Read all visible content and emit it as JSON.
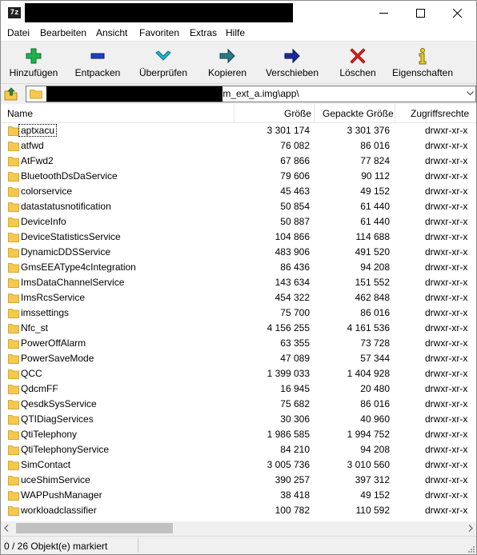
{
  "window": {
    "app_icon_text": "7z"
  },
  "menu": [
    "Datei",
    "Bearbeiten",
    "Ansicht",
    "Favoriten",
    "Extras",
    "Hilfe"
  ],
  "toolbar": {
    "add": "Hinzufügen",
    "extract": "Entpacken",
    "test": "Überprüfen",
    "copy": "Kopieren",
    "move": "Verschieben",
    "delete": "Löschen",
    "info": "Eigenschaften"
  },
  "address": {
    "path": "\\system_ext_a.img\\app\\"
  },
  "columns": {
    "name": "Name",
    "size": "Größe",
    "packed": "Gepackte Größe",
    "permissions": "Zugriffsrechte"
  },
  "rows": [
    {
      "name": "aptxacu",
      "size": "3 301 174",
      "packed": "3 301 376",
      "perm": "drwxr-xr-x"
    },
    {
      "name": "atfwd",
      "size": "76 082",
      "packed": "86 016",
      "perm": "drwxr-xr-x"
    },
    {
      "name": "AtFwd2",
      "size": "67 866",
      "packed": "77 824",
      "perm": "drwxr-xr-x"
    },
    {
      "name": "BluetoothDsDaService",
      "size": "79 606",
      "packed": "90 112",
      "perm": "drwxr-xr-x"
    },
    {
      "name": "colorservice",
      "size": "45 463",
      "packed": "49 152",
      "perm": "drwxr-xr-x"
    },
    {
      "name": "datastatusnotification",
      "size": "50 854",
      "packed": "61 440",
      "perm": "drwxr-xr-x"
    },
    {
      "name": "DeviceInfo",
      "size": "50 887",
      "packed": "61 440",
      "perm": "drwxr-xr-x"
    },
    {
      "name": "DeviceStatisticsService",
      "size": "104 866",
      "packed": "114 688",
      "perm": "drwxr-xr-x"
    },
    {
      "name": "DynamicDDSService",
      "size": "483 906",
      "packed": "491 520",
      "perm": "drwxr-xr-x"
    },
    {
      "name": "GmsEEAType4cIntegration",
      "size": "86 436",
      "packed": "94 208",
      "perm": "drwxr-xr-x"
    },
    {
      "name": "ImsDataChannelService",
      "size": "143 634",
      "packed": "151 552",
      "perm": "drwxr-xr-x"
    },
    {
      "name": "ImsRcsService",
      "size": "454 322",
      "packed": "462 848",
      "perm": "drwxr-xr-x"
    },
    {
      "name": "imssettings",
      "size": "75 700",
      "packed": "86 016",
      "perm": "drwxr-xr-x"
    },
    {
      "name": "Nfc_st",
      "size": "4 156 255",
      "packed": "4 161 536",
      "perm": "drwxr-xr-x"
    },
    {
      "name": "PowerOffAlarm",
      "size": "63 355",
      "packed": "73 728",
      "perm": "drwxr-xr-x"
    },
    {
      "name": "PowerSaveMode",
      "size": "47 089",
      "packed": "57 344",
      "perm": "drwxr-xr-x"
    },
    {
      "name": "QCC",
      "size": "1 399 033",
      "packed": "1 404 928",
      "perm": "drwxr-xr-x"
    },
    {
      "name": "QdcmFF",
      "size": "16 945",
      "packed": "20 480",
      "perm": "drwxr-xr-x"
    },
    {
      "name": "QesdkSysService",
      "size": "75 682",
      "packed": "86 016",
      "perm": "drwxr-xr-x"
    },
    {
      "name": "QTIDiagServices",
      "size": "30 306",
      "packed": "40 960",
      "perm": "drwxr-xr-x"
    },
    {
      "name": "QtiTelephony",
      "size": "1 986 585",
      "packed": "1 994 752",
      "perm": "drwxr-xr-x"
    },
    {
      "name": "QtiTelephonyService",
      "size": "84 210",
      "packed": "94 208",
      "perm": "drwxr-xr-x"
    },
    {
      "name": "SimContact",
      "size": "3 005 736",
      "packed": "3 010 560",
      "perm": "drwxr-xr-x"
    },
    {
      "name": "uceShimService",
      "size": "390 257",
      "packed": "397 312",
      "perm": "drwxr-xr-x"
    },
    {
      "name": "WAPPushManager",
      "size": "38 418",
      "packed": "49 152",
      "perm": "drwxr-xr-x"
    },
    {
      "name": "workloadclassifier",
      "size": "100 782",
      "packed": "110 592",
      "perm": "drwxr-xr-x"
    }
  ],
  "status": {
    "text": "0 / 26 Objekt(e) markiert"
  },
  "colors": {
    "folder": "#f4c94e",
    "folder_edge": "#d9a930",
    "add_icon": "#22b14c",
    "extract_icon": "#1e3fc0",
    "test_icon": "#23b5d3",
    "copy_icon": "#2b7a8a",
    "move_icon": "#1c2a9c",
    "delete_icon": "#e02020",
    "info_icon": "#e8d020"
  },
  "icons": {
    "up": "folder-up-icon",
    "add": "plus-icon",
    "extract": "minus-icon",
    "test": "checkmark-icon",
    "copy": "arrow-right-icon",
    "move": "arrow-right-icon",
    "delete": "x-icon",
    "info": "info-icon"
  }
}
